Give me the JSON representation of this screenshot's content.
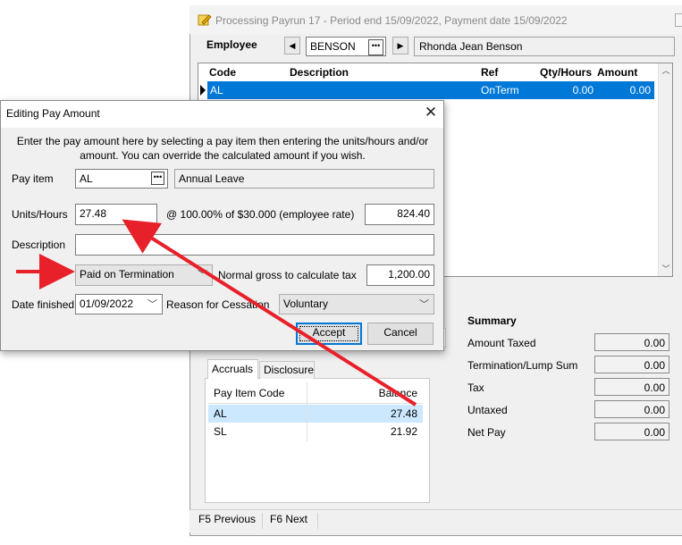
{
  "background_window": {
    "title": "Processing Payrun 17 - Period end 15/09/2022, Payment date 15/09/2022",
    "employee_label": "Employee",
    "employee_code": "BENSON",
    "employee_name": "Rhonda Jean Benson",
    "grid": {
      "columns": [
        "Code",
        "Description",
        "Ref",
        "Qty/Hours",
        "Amount"
      ],
      "rows": [
        {
          "code": "AL",
          "description": "",
          "ref": "OnTerm",
          "qty": "0.00",
          "amount": "0.00",
          "selected": true
        }
      ]
    },
    "summary": {
      "title": "Summary",
      "items": [
        {
          "label": "Amount Taxed",
          "value": "0.00"
        },
        {
          "label": "Termination/Lump Sum",
          "value": "0.00"
        },
        {
          "label": "Tax",
          "value": "0.00"
        },
        {
          "label": "Untaxed",
          "value": "0.00"
        },
        {
          "label": "Net Pay",
          "value": "0.00"
        }
      ]
    },
    "tabs": [
      "Accruals",
      "Disclosure"
    ],
    "accruals": {
      "columns": [
        "Pay Item Code",
        "Balance"
      ],
      "rows": [
        {
          "code": "AL",
          "balance": "27.48",
          "selected": true
        },
        {
          "code": "SL",
          "balance": "21.92",
          "selected": false
        }
      ]
    },
    "status_bar": [
      "F5 Previous",
      "F6 Next"
    ]
  },
  "dialog": {
    "title": "Editing Pay Amount",
    "instruction_line1": "Enter the pay amount here by selecting a pay item then entering the units/hours and/or",
    "instruction_line2": "amount. You can override the calculated amount if you wish.",
    "pay_item_label": "Pay item",
    "pay_item_code": "AL",
    "pay_item_name": "Annual Leave",
    "units_label": "Units/Hours",
    "units_value": "27.48",
    "rate_text": "@  100.00% of $30.000  (employee rate)",
    "calculated_amount": "824.40",
    "description_label": "Description",
    "description_value": "",
    "payment_type": "Paid on Termination",
    "normal_gross_label": "Normal gross to calculate tax",
    "normal_gross_value": "1,200.00",
    "date_finished_label": "Date finished",
    "date_finished_value": "01/09/2022",
    "reason_label": "Reason for Cessation",
    "reason_value": "Voluntary",
    "accept_label": "Accept",
    "cancel_label": "Cancel"
  },
  "colors": {
    "selection": "#0078d7",
    "annotation_arrow": "#e8202a",
    "accrual_selection": "#cce8ff"
  }
}
